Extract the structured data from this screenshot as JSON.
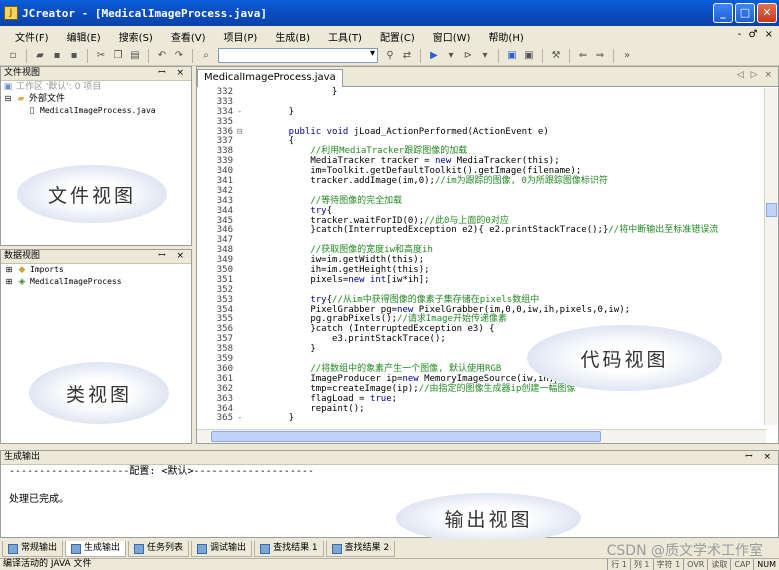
{
  "window": {
    "title": "JCreator - [MedicalImageProcess.java]",
    "controls": {
      "minimize": "_",
      "maximize": "□",
      "close": "✕"
    }
  },
  "menubar": {
    "items": [
      "文件(F)",
      "编辑(E)",
      "搜索(S)",
      "查看(V)",
      "项目(P)",
      "生成(B)",
      "工具(T)",
      "配置(C)",
      "窗口(W)",
      "帮助(H)"
    ],
    "right_controls": "- ♂ ×"
  },
  "file_view": {
    "header": "文件视图",
    "header_controls": "ꟷ ×",
    "workspace": "工作区 '默认': 0 项目",
    "external_files": "外部文件",
    "file": "MedicalImageProcess.java",
    "callout": "文件视图"
  },
  "data_view": {
    "header": "数据视图",
    "header_controls": "ꟷ ×",
    "items": [
      "Imports",
      "MedicalImageProcess"
    ],
    "callout": "类视图"
  },
  "editor": {
    "tab_label": "MedicalImageProcess.java",
    "tab_arrows": "◁ ▷ ×",
    "callout": "代码视图",
    "lines": [
      {
        "n": "332",
        "fold": "",
        "segments": [
          {
            "t": "            }",
            "c": ""
          }
        ]
      },
      {
        "n": "333",
        "fold": "",
        "segments": [
          {
            "t": "",
            "c": ""
          }
        ]
      },
      {
        "n": "334",
        "fold": "-",
        "segments": [
          {
            "t": "    }",
            "c": ""
          }
        ]
      },
      {
        "n": "335",
        "fold": "",
        "segments": [
          {
            "t": "",
            "c": ""
          }
        ]
      },
      {
        "n": "336",
        "fold": "⊟",
        "segments": [
          {
            "t": "    public void ",
            "c": "kw"
          },
          {
            "t": "jLoad_ActionPerformed(ActionEvent e)",
            "c": ""
          }
        ]
      },
      {
        "n": "337",
        "fold": "",
        "segments": [
          {
            "t": "    {",
            "c": ""
          }
        ]
      },
      {
        "n": "338",
        "fold": "",
        "segments": [
          {
            "t": "        //利用MediaTracker跟踪图像的加载",
            "c": "cm"
          }
        ]
      },
      {
        "n": "339",
        "fold": "",
        "segments": [
          {
            "t": "        MediaTracker tracker = ",
            "c": ""
          },
          {
            "t": "new",
            "c": "kw"
          },
          {
            "t": " MediaTracker(this);",
            "c": ""
          }
        ]
      },
      {
        "n": "340",
        "fold": "",
        "segments": [
          {
            "t": "        im=Toolkit.getDefaultToolkit().getImage(filename);",
            "c": ""
          }
        ]
      },
      {
        "n": "341",
        "fold": "",
        "segments": [
          {
            "t": "        tracker.addImage(im,0);",
            "c": ""
          },
          {
            "t": "//im为跟踪的图像, 0为所跟踪图像标识符",
            "c": "cm"
          }
        ]
      },
      {
        "n": "342",
        "fold": "",
        "segments": [
          {
            "t": "",
            "c": ""
          }
        ]
      },
      {
        "n": "343",
        "fold": "",
        "segments": [
          {
            "t": "        //等待图像的完全加载",
            "c": "cm"
          }
        ]
      },
      {
        "n": "344",
        "fold": "",
        "segments": [
          {
            "t": "        try",
            "c": "kw"
          },
          {
            "t": "{",
            "c": ""
          }
        ]
      },
      {
        "n": "345",
        "fold": "",
        "segments": [
          {
            "t": "        tracker.waitForID(0);",
            "c": ""
          },
          {
            "t": "//此0与上面的0对应",
            "c": "cm"
          }
        ]
      },
      {
        "n": "346",
        "fold": "",
        "segments": [
          {
            "t": "        }catch(InterruptedException e2){ e2.printStackTrace();}",
            "c": ""
          },
          {
            "t": "//将中断输出至标准错误流",
            "c": "cm"
          }
        ]
      },
      {
        "n": "347",
        "fold": "",
        "segments": [
          {
            "t": "",
            "c": ""
          }
        ]
      },
      {
        "n": "348",
        "fold": "",
        "segments": [
          {
            "t": "        //获取图像的宽度iw和高度ih",
            "c": "cm"
          }
        ]
      },
      {
        "n": "349",
        "fold": "",
        "segments": [
          {
            "t": "        iw=im.getWidth(this);",
            "c": ""
          }
        ]
      },
      {
        "n": "350",
        "fold": "",
        "segments": [
          {
            "t": "        ih=im.getHeight(this);",
            "c": ""
          }
        ]
      },
      {
        "n": "351",
        "fold": "",
        "segments": [
          {
            "t": "        pixels=",
            "c": ""
          },
          {
            "t": "new int",
            "c": "kw"
          },
          {
            "t": "[iw*ih];",
            "c": ""
          }
        ]
      },
      {
        "n": "352",
        "fold": "",
        "segments": [
          {
            "t": "",
            "c": ""
          }
        ]
      },
      {
        "n": "353",
        "fold": "",
        "segments": [
          {
            "t": "        try",
            "c": "kw"
          },
          {
            "t": "{",
            "c": ""
          },
          {
            "t": "//从im中获得图像的像素子集存储在pixels数组中",
            "c": "cm"
          }
        ]
      },
      {
        "n": "354",
        "fold": "",
        "segments": [
          {
            "t": "        PixelGrabber pg=",
            "c": ""
          },
          {
            "t": "new",
            "c": "kw"
          },
          {
            "t": " PixelGrabber(im,0,0,iw,ih,pixels,0,iw);",
            "c": ""
          }
        ]
      },
      {
        "n": "355",
        "fold": "",
        "segments": [
          {
            "t": "        pg.grabPixels();",
            "c": ""
          },
          {
            "t": "//请求Image开始传递像素",
            "c": "cm"
          }
        ]
      },
      {
        "n": "356",
        "fold": "",
        "segments": [
          {
            "t": "        }catch (InterruptedException e3) {",
            "c": ""
          }
        ]
      },
      {
        "n": "357",
        "fold": "",
        "segments": [
          {
            "t": "            e3.printStackTrace();",
            "c": ""
          }
        ]
      },
      {
        "n": "358",
        "fold": "",
        "segments": [
          {
            "t": "        }",
            "c": ""
          }
        ]
      },
      {
        "n": "359",
        "fold": "",
        "segments": [
          {
            "t": "",
            "c": ""
          }
        ]
      },
      {
        "n": "360",
        "fold": "",
        "segments": [
          {
            "t": "        //将数组中的象素产生一个图像, 默认使用RGB",
            "c": "cm"
          }
        ]
      },
      {
        "n": "361",
        "fold": "",
        "segments": [
          {
            "t": "        ImageProducer ip=",
            "c": ""
          },
          {
            "t": "new",
            "c": "kw"
          },
          {
            "t": " MemoryImageSource(iw,ih,pixe",
            "c": ""
          }
        ]
      },
      {
        "n": "362",
        "fold": "",
        "segments": [
          {
            "t": "        tmp=createImage(ip);",
            "c": ""
          },
          {
            "t": "//由指定的图像生成器ip创建一幅图像",
            "c": "cm"
          }
        ]
      },
      {
        "n": "363",
        "fold": "",
        "segments": [
          {
            "t": "        flagLoad = ",
            "c": ""
          },
          {
            "t": "true",
            "c": "kw"
          },
          {
            "t": ";",
            "c": ""
          }
        ]
      },
      {
        "n": "364",
        "fold": "",
        "segments": [
          {
            "t": "        repaint();",
            "c": ""
          }
        ]
      },
      {
        "n": "365",
        "fold": "-",
        "segments": [
          {
            "t": "    }",
            "c": ""
          }
        ]
      }
    ]
  },
  "output": {
    "header": "生成输出",
    "header_controls": "ꟷ ×",
    "lines": [
      "--------------------配置: <默认>--------------------",
      "",
      "处理已完成。"
    ],
    "callout": "输出视图"
  },
  "bottom_tabs": [
    "常规输出",
    "生成输出",
    "任务列表",
    "调试输出",
    "查找结果 1",
    "查找结果 2"
  ],
  "statusbar": {
    "message": "编译活动的 JAVA 文件",
    "cells": [
      "行 1",
      "列 1",
      "字符 1",
      "OVR",
      "读取",
      "CAP",
      "NUM"
    ]
  },
  "watermark": "CSDN @质文学术工作室"
}
